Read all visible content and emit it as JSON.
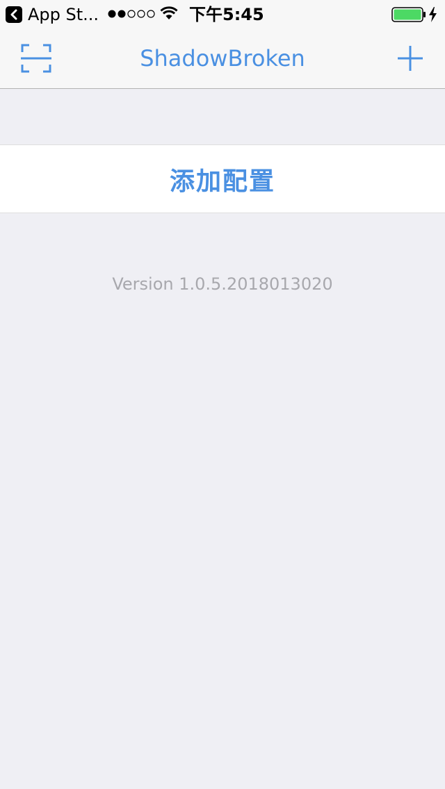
{
  "status_bar": {
    "back_app_label": "App St...",
    "time": "下午5:45",
    "signal_bars_filled": 2,
    "signal_bars_total": 5,
    "battery_level": 1.0,
    "charging": true
  },
  "nav_bar": {
    "title": "ShadowBroken",
    "left_icon": "scan-icon",
    "right_icon": "plus-icon"
  },
  "main": {
    "add_config_label": "添加配置",
    "version_text": "Version 1.0.5.2018013020"
  },
  "colors": {
    "accent": "#4a90e2",
    "background": "#efeff4",
    "version_text": "#a8a8ad",
    "battery_fill": "#4cd964"
  }
}
